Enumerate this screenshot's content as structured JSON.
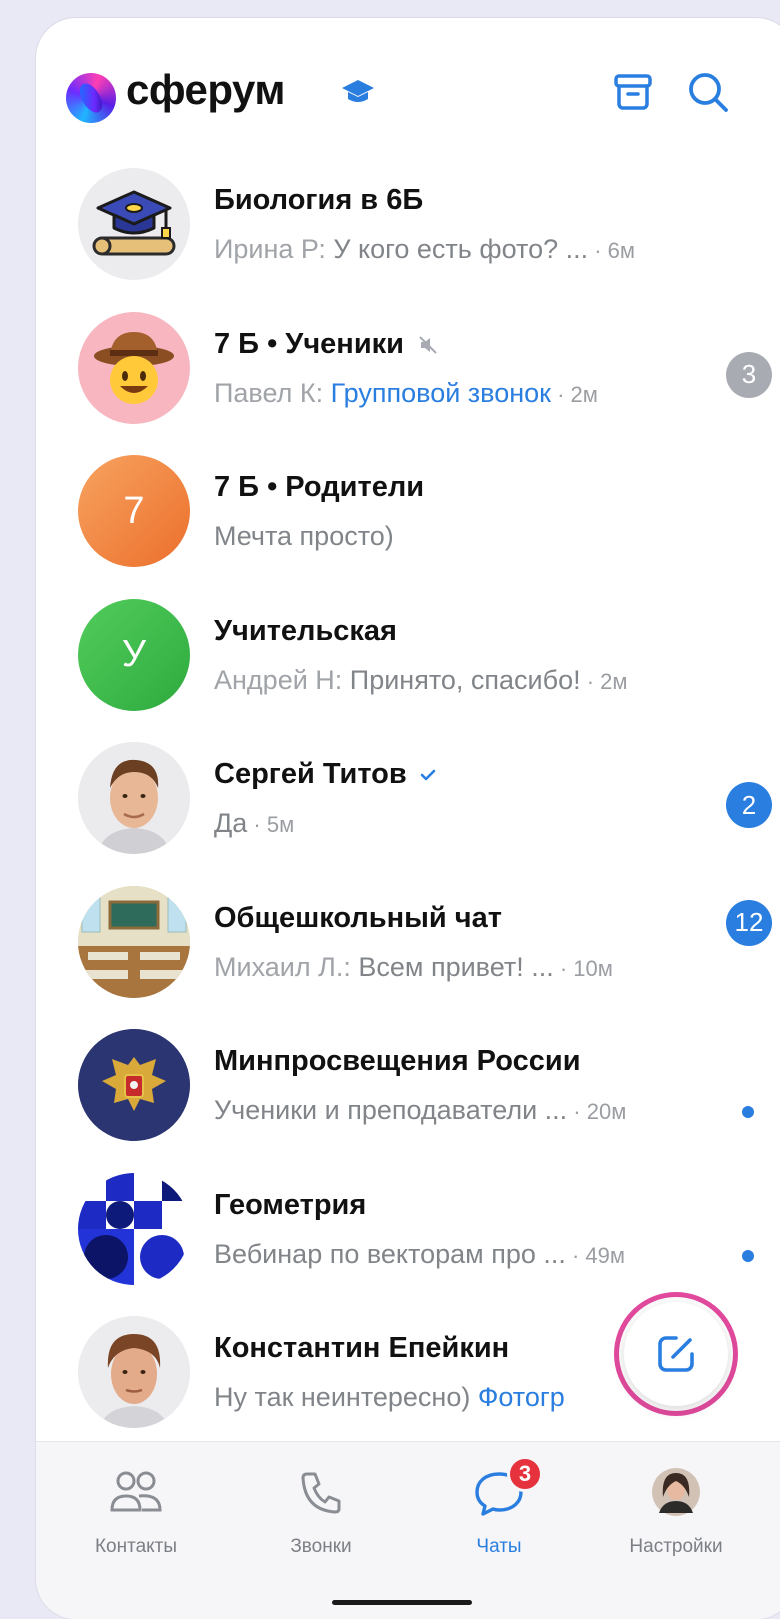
{
  "app": {
    "brand_name": "сферум",
    "accent_color": "#2a7ee0"
  },
  "header": {
    "icons": [
      "graduation-hat-icon",
      "archive-icon",
      "search-icon"
    ]
  },
  "chats": [
    {
      "title": "Биология в 6Б",
      "author": "Ирина Р: ",
      "message": "У кого есть фото? ...",
      "time": " · 6м",
      "badge": "",
      "avatar": "graduation-cap-image"
    },
    {
      "title": "7 Б • Ученики",
      "author": "Павел К: ",
      "message": "Групповой звонок",
      "time": " · 2м",
      "badge": "3",
      "muted": true,
      "avatar": "cowboy-emoji-image"
    },
    {
      "title": "7 Б • Родители",
      "author": "",
      "message": "Мечта просто)",
      "time": "",
      "badge": "",
      "avatar_letter": "7",
      "avatar_color": "#f08a48"
    },
    {
      "title": "Учительская",
      "author": "Андрей Н: ",
      "message": "Принято, спасибо!",
      "time": " · 2м",
      "badge": "",
      "avatar_letter": "У",
      "avatar_color": "#3fbd4e"
    },
    {
      "title": "Сергей Титов",
      "author": "",
      "message": "Да",
      "time": " · 5м",
      "badge": "2",
      "verified": true,
      "avatar": "man-photo"
    },
    {
      "title": "Общешкольный чат",
      "author": "Михаил Л.: ",
      "message": "Всем привет! ...",
      "time": " · 10м",
      "badge": "12",
      "avatar": "classroom-photo"
    },
    {
      "title": "Минпросвещения России",
      "author": "",
      "message": "Ученики и преподаватели ...",
      "time": " · 20м",
      "badge": "",
      "unread_dot": true,
      "avatar": "coat-of-arms-image"
    },
    {
      "title": "Геометрия",
      "author": "",
      "message": "Вебинар по векторам про ...",
      "time": " · 49м",
      "badge": "",
      "unread_dot": true,
      "avatar": "geometric-pattern-image"
    },
    {
      "title": "Константин Епейкин",
      "author": "",
      "message": "Ну так неинтересно) ",
      "link": "Фотогр",
      "time": "",
      "badge": "",
      "avatar": "man-photo-2"
    }
  ],
  "bottom_nav": {
    "items": [
      {
        "label": "Контакты",
        "icon": "contacts-icon"
      },
      {
        "label": "Звонки",
        "icon": "phone-icon"
      },
      {
        "label": "Чаты",
        "icon": "chat-bubble-icon",
        "badge": "3",
        "active": true
      },
      {
        "label": "Настройки",
        "icon": "profile-avatar"
      }
    ]
  }
}
